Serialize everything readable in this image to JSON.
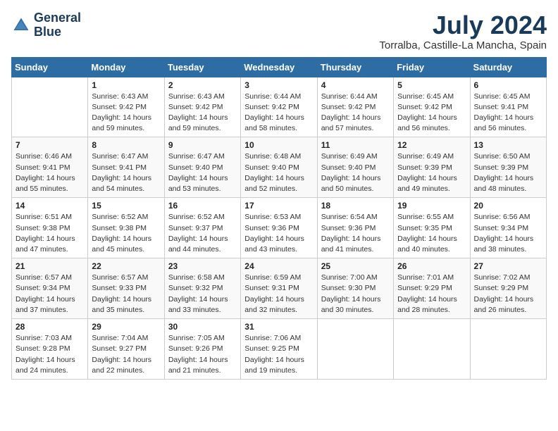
{
  "logo": {
    "line1": "General",
    "line2": "Blue"
  },
  "title": "July 2024",
  "location": "Torralba, Castille-La Mancha, Spain",
  "header_days": [
    "Sunday",
    "Monday",
    "Tuesday",
    "Wednesday",
    "Thursday",
    "Friday",
    "Saturday"
  ],
  "weeks": [
    [
      {
        "day": "",
        "sunrise": "",
        "sunset": "",
        "daylight": ""
      },
      {
        "day": "1",
        "sunrise": "Sunrise: 6:43 AM",
        "sunset": "Sunset: 9:42 PM",
        "daylight": "Daylight: 14 hours and 59 minutes."
      },
      {
        "day": "2",
        "sunrise": "Sunrise: 6:43 AM",
        "sunset": "Sunset: 9:42 PM",
        "daylight": "Daylight: 14 hours and 59 minutes."
      },
      {
        "day": "3",
        "sunrise": "Sunrise: 6:44 AM",
        "sunset": "Sunset: 9:42 PM",
        "daylight": "Daylight: 14 hours and 58 minutes."
      },
      {
        "day": "4",
        "sunrise": "Sunrise: 6:44 AM",
        "sunset": "Sunset: 9:42 PM",
        "daylight": "Daylight: 14 hours and 57 minutes."
      },
      {
        "day": "5",
        "sunrise": "Sunrise: 6:45 AM",
        "sunset": "Sunset: 9:42 PM",
        "daylight": "Daylight: 14 hours and 56 minutes."
      },
      {
        "day": "6",
        "sunrise": "Sunrise: 6:45 AM",
        "sunset": "Sunset: 9:41 PM",
        "daylight": "Daylight: 14 hours and 56 minutes."
      }
    ],
    [
      {
        "day": "7",
        "sunrise": "Sunrise: 6:46 AM",
        "sunset": "Sunset: 9:41 PM",
        "daylight": "Daylight: 14 hours and 55 minutes."
      },
      {
        "day": "8",
        "sunrise": "Sunrise: 6:47 AM",
        "sunset": "Sunset: 9:41 PM",
        "daylight": "Daylight: 14 hours and 54 minutes."
      },
      {
        "day": "9",
        "sunrise": "Sunrise: 6:47 AM",
        "sunset": "Sunset: 9:40 PM",
        "daylight": "Daylight: 14 hours and 53 minutes."
      },
      {
        "day": "10",
        "sunrise": "Sunrise: 6:48 AM",
        "sunset": "Sunset: 9:40 PM",
        "daylight": "Daylight: 14 hours and 52 minutes."
      },
      {
        "day": "11",
        "sunrise": "Sunrise: 6:49 AM",
        "sunset": "Sunset: 9:40 PM",
        "daylight": "Daylight: 14 hours and 50 minutes."
      },
      {
        "day": "12",
        "sunrise": "Sunrise: 6:49 AM",
        "sunset": "Sunset: 9:39 PM",
        "daylight": "Daylight: 14 hours and 49 minutes."
      },
      {
        "day": "13",
        "sunrise": "Sunrise: 6:50 AM",
        "sunset": "Sunset: 9:39 PM",
        "daylight": "Daylight: 14 hours and 48 minutes."
      }
    ],
    [
      {
        "day": "14",
        "sunrise": "Sunrise: 6:51 AM",
        "sunset": "Sunset: 9:38 PM",
        "daylight": "Daylight: 14 hours and 47 minutes."
      },
      {
        "day": "15",
        "sunrise": "Sunrise: 6:52 AM",
        "sunset": "Sunset: 9:38 PM",
        "daylight": "Daylight: 14 hours and 45 minutes."
      },
      {
        "day": "16",
        "sunrise": "Sunrise: 6:52 AM",
        "sunset": "Sunset: 9:37 PM",
        "daylight": "Daylight: 14 hours and 44 minutes."
      },
      {
        "day": "17",
        "sunrise": "Sunrise: 6:53 AM",
        "sunset": "Sunset: 9:36 PM",
        "daylight": "Daylight: 14 hours and 43 minutes."
      },
      {
        "day": "18",
        "sunrise": "Sunrise: 6:54 AM",
        "sunset": "Sunset: 9:36 PM",
        "daylight": "Daylight: 14 hours and 41 minutes."
      },
      {
        "day": "19",
        "sunrise": "Sunrise: 6:55 AM",
        "sunset": "Sunset: 9:35 PM",
        "daylight": "Daylight: 14 hours and 40 minutes."
      },
      {
        "day": "20",
        "sunrise": "Sunrise: 6:56 AM",
        "sunset": "Sunset: 9:34 PM",
        "daylight": "Daylight: 14 hours and 38 minutes."
      }
    ],
    [
      {
        "day": "21",
        "sunrise": "Sunrise: 6:57 AM",
        "sunset": "Sunset: 9:34 PM",
        "daylight": "Daylight: 14 hours and 37 minutes."
      },
      {
        "day": "22",
        "sunrise": "Sunrise: 6:57 AM",
        "sunset": "Sunset: 9:33 PM",
        "daylight": "Daylight: 14 hours and 35 minutes."
      },
      {
        "day": "23",
        "sunrise": "Sunrise: 6:58 AM",
        "sunset": "Sunset: 9:32 PM",
        "daylight": "Daylight: 14 hours and 33 minutes."
      },
      {
        "day": "24",
        "sunrise": "Sunrise: 6:59 AM",
        "sunset": "Sunset: 9:31 PM",
        "daylight": "Daylight: 14 hours and 32 minutes."
      },
      {
        "day": "25",
        "sunrise": "Sunrise: 7:00 AM",
        "sunset": "Sunset: 9:30 PM",
        "daylight": "Daylight: 14 hours and 30 minutes."
      },
      {
        "day": "26",
        "sunrise": "Sunrise: 7:01 AM",
        "sunset": "Sunset: 9:29 PM",
        "daylight": "Daylight: 14 hours and 28 minutes."
      },
      {
        "day": "27",
        "sunrise": "Sunrise: 7:02 AM",
        "sunset": "Sunset: 9:29 PM",
        "daylight": "Daylight: 14 hours and 26 minutes."
      }
    ],
    [
      {
        "day": "28",
        "sunrise": "Sunrise: 7:03 AM",
        "sunset": "Sunset: 9:28 PM",
        "daylight": "Daylight: 14 hours and 24 minutes."
      },
      {
        "day": "29",
        "sunrise": "Sunrise: 7:04 AM",
        "sunset": "Sunset: 9:27 PM",
        "daylight": "Daylight: 14 hours and 22 minutes."
      },
      {
        "day": "30",
        "sunrise": "Sunrise: 7:05 AM",
        "sunset": "Sunset: 9:26 PM",
        "daylight": "Daylight: 14 hours and 21 minutes."
      },
      {
        "day": "31",
        "sunrise": "Sunrise: 7:06 AM",
        "sunset": "Sunset: 9:25 PM",
        "daylight": "Daylight: 14 hours and 19 minutes."
      },
      {
        "day": "",
        "sunrise": "",
        "sunset": "",
        "daylight": ""
      },
      {
        "day": "",
        "sunrise": "",
        "sunset": "",
        "daylight": ""
      },
      {
        "day": "",
        "sunrise": "",
        "sunset": "",
        "daylight": ""
      }
    ]
  ]
}
